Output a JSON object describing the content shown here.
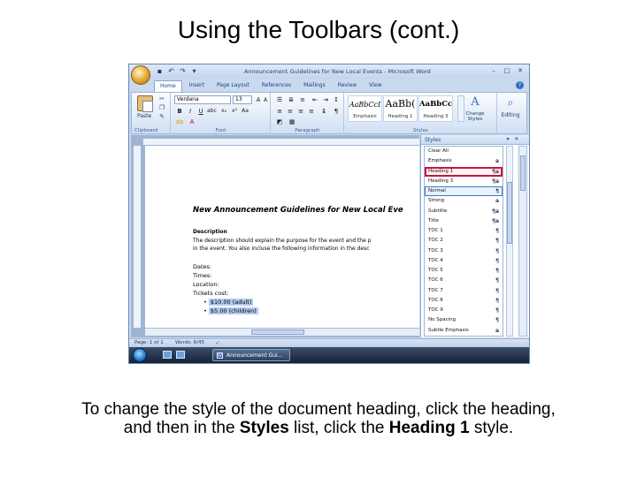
{
  "slide": {
    "title": "Using the Toolbars (cont.)",
    "caption": {
      "part1": "To change the style of the document heading, click the heading,",
      "part2": "and then in the ",
      "styles_word": "Styles",
      "part3": " list, click the ",
      "heading_word": "Heading 1",
      "part4": " style."
    }
  },
  "window": {
    "title": "Announcement Guidelines for New Local Events - Microsoft Word",
    "qat": [
      "save-icon",
      "undo-icon",
      "redo-icon",
      "customize-icon"
    ],
    "controls": [
      "–",
      "□",
      "✕"
    ]
  },
  "ribbon": {
    "tabs": [
      "Home",
      "Insert",
      "Page Layout",
      "References",
      "Mailings",
      "Review",
      "View"
    ],
    "active_tab": "Home",
    "help": "?",
    "clipboard": {
      "label": "Clipboard",
      "paste": "Paste"
    },
    "font": {
      "label": "Font",
      "name": "Verdana",
      "size": "13",
      "bold": "B",
      "italic": "I",
      "underline": "U",
      "grow": "A",
      "shrink": "A",
      "color": "A",
      "clear": "Aa"
    },
    "paragraph": {
      "label": "Paragraph",
      "pilcrow": "¶"
    },
    "styles": {
      "label": "Styles",
      "gallery": [
        {
          "sample": "AaBbCcI",
          "name": "Emphasis"
        },
        {
          "sample": "AaBb(",
          "name": "Heading 1"
        },
        {
          "sample": "AaBbCc",
          "name": "Heading 3"
        }
      ],
      "change_styles": "Change Styles"
    },
    "editing": {
      "label": "Editing"
    }
  },
  "document": {
    "heading": "New Announcement Guidelines for New Local Eve",
    "description_label": "Description",
    "description_line1": "The description should explain the purpose for the event and the p",
    "description_line2": "in the event. You also incluse the following information in the desc",
    "list": [
      "Dates:",
      "Times:",
      "Location:",
      "Tickets cost:"
    ],
    "bullets": [
      "$10.00 (adult)",
      "$5.00 (children)"
    ]
  },
  "status": {
    "page": "Page: 1 of 1",
    "words": "Words: 6/45"
  },
  "taskbar": {
    "task_label": "Announcement Gui..."
  },
  "styles_pane": {
    "title": "Styles",
    "items": [
      {
        "name": "Clear All",
        "symbol": ""
      },
      {
        "name": "Emphasis",
        "symbol": "a"
      },
      {
        "name": "Heading 1",
        "symbol": "¶a",
        "state": "red"
      },
      {
        "name": "Heading 3",
        "symbol": "¶a"
      },
      {
        "name": "Normal",
        "symbol": "¶",
        "state": "blue"
      },
      {
        "name": "Strong",
        "symbol": "a"
      },
      {
        "name": "Subtitle",
        "symbol": "¶a"
      },
      {
        "name": "Title",
        "symbol": "¶a"
      },
      {
        "name": "TOC 1",
        "symbol": "¶"
      },
      {
        "name": "TOC 2",
        "symbol": "¶"
      },
      {
        "name": "TOC 3",
        "symbol": "¶"
      },
      {
        "name": "TOC 4",
        "symbol": "¶"
      },
      {
        "name": "TOC 5",
        "symbol": "¶"
      },
      {
        "name": "TOC 6",
        "symbol": "¶"
      },
      {
        "name": "TOC 7",
        "symbol": "¶"
      },
      {
        "name": "TOC 8",
        "symbol": "¶"
      },
      {
        "name": "TOC 9",
        "symbol": "¶"
      },
      {
        "name": "No Spacing",
        "symbol": "¶"
      },
      {
        "name": "Subtle Emphasis",
        "symbol": "a"
      }
    ]
  },
  "colors": {
    "selection_red": "#d0113a",
    "selection_blue": "#3f78c8",
    "ribbon_blue": "#15428b"
  }
}
